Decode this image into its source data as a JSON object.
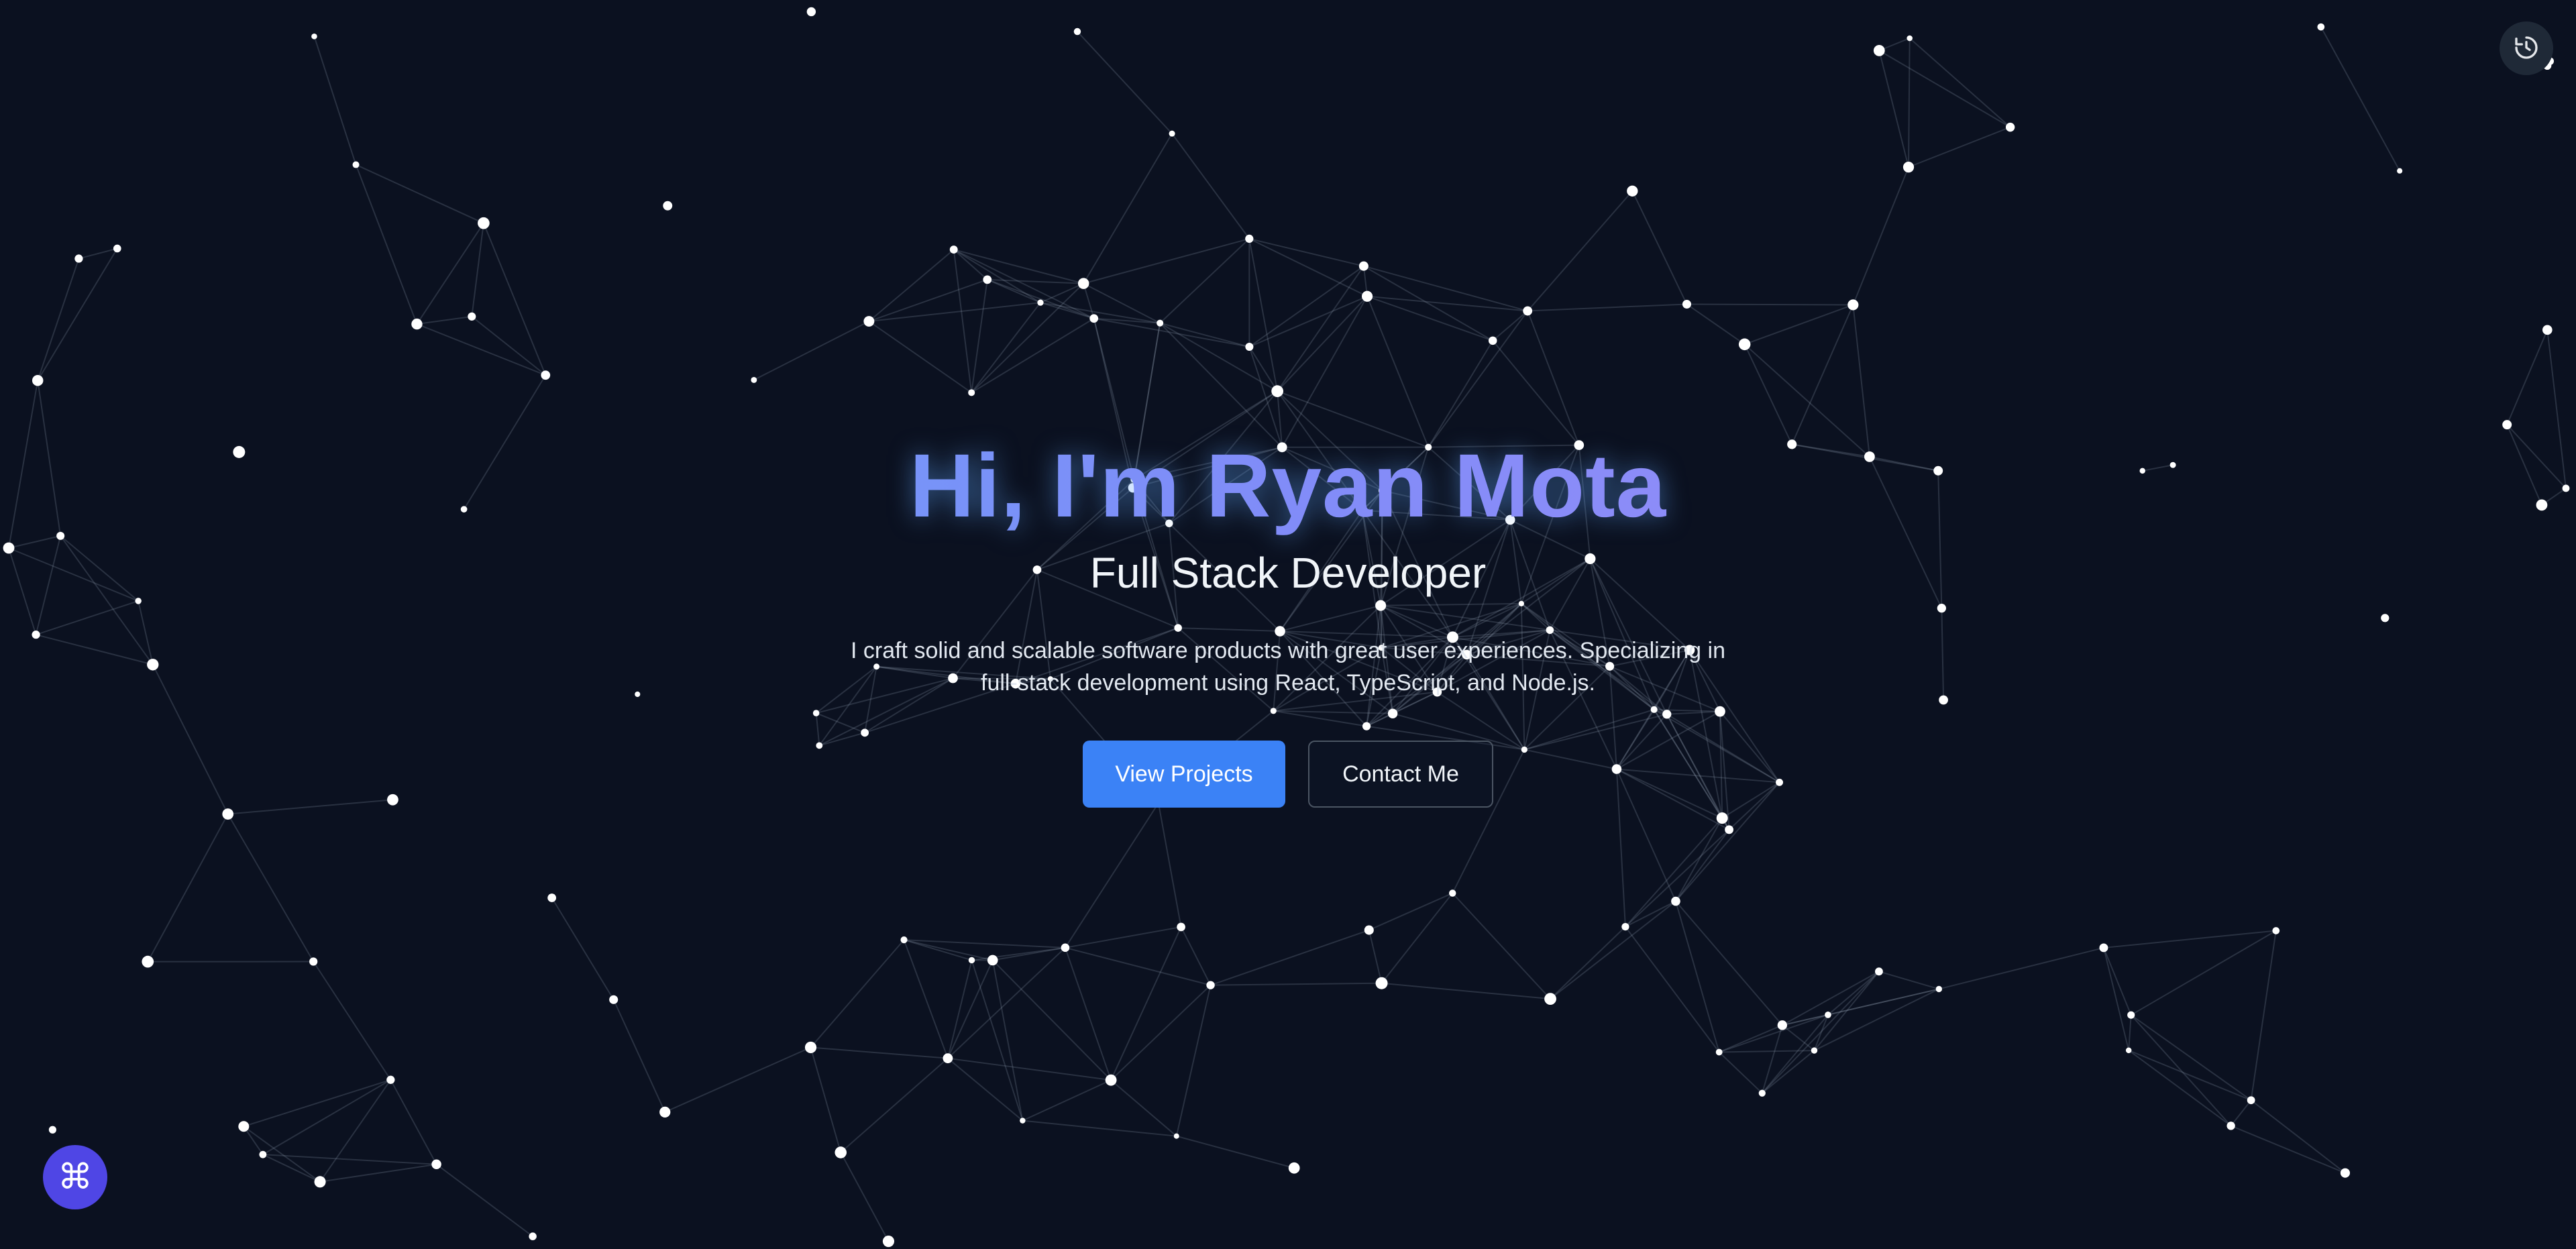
{
  "hero": {
    "title": "Hi, I'm Ryan Mota",
    "subtitle": "Full Stack Developer",
    "description": "I craft solid and scalable software products with great user experiences. Specializing in full-stack development using React, TypeScript, and Node.js."
  },
  "actions": {
    "primary_label": "View Projects",
    "secondary_label": "Contact Me"
  },
  "controls": {
    "theme_toggle_icon": "theme-toggle-icon",
    "command_icon": "⌘"
  },
  "colors": {
    "background": "#0b1120",
    "accent_blue": "#3b82f6",
    "gradient_start": "#60a5fa",
    "gradient_end": "#a78bfa",
    "command_button": "#4f46e5"
  }
}
